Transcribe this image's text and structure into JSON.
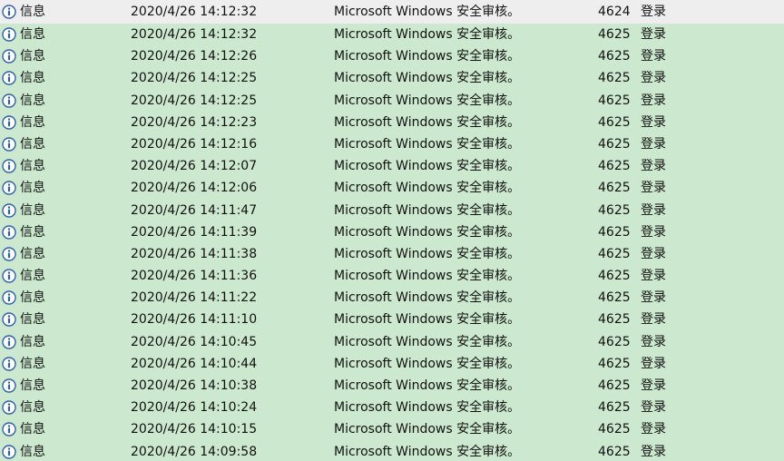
{
  "colors": {
    "background": "#cce8cf",
    "selected_row": "#eeeeee",
    "info_icon": "#2f5fa8"
  },
  "rows": [
    {
      "icon": "info-icon",
      "level": "信息",
      "date": "2020/4/26 14:12:32",
      "source": "Microsoft Windows 安全审核。",
      "event_id": "4624",
      "task": "登录",
      "selected": true
    },
    {
      "icon": "info-icon",
      "level": "信息",
      "date": "2020/4/26 14:12:32",
      "source": "Microsoft Windows 安全审核。",
      "event_id": "4625",
      "task": "登录",
      "selected": false
    },
    {
      "icon": "info-icon",
      "level": "信息",
      "date": "2020/4/26 14:12:26",
      "source": "Microsoft Windows 安全审核。",
      "event_id": "4625",
      "task": "登录",
      "selected": false
    },
    {
      "icon": "info-icon",
      "level": "信息",
      "date": "2020/4/26 14:12:25",
      "source": "Microsoft Windows 安全审核。",
      "event_id": "4625",
      "task": "登录",
      "selected": false
    },
    {
      "icon": "info-icon",
      "level": "信息",
      "date": "2020/4/26 14:12:25",
      "source": "Microsoft Windows 安全审核。",
      "event_id": "4625",
      "task": "登录",
      "selected": false
    },
    {
      "icon": "info-icon",
      "level": "信息",
      "date": "2020/4/26 14:12:23",
      "source": "Microsoft Windows 安全审核。",
      "event_id": "4625",
      "task": "登录",
      "selected": false
    },
    {
      "icon": "info-icon",
      "level": "信息",
      "date": "2020/4/26 14:12:16",
      "source": "Microsoft Windows 安全审核。",
      "event_id": "4625",
      "task": "登录",
      "selected": false
    },
    {
      "icon": "info-icon",
      "level": "信息",
      "date": "2020/4/26 14:12:07",
      "source": "Microsoft Windows 安全审核。",
      "event_id": "4625",
      "task": "登录",
      "selected": false
    },
    {
      "icon": "info-icon",
      "level": "信息",
      "date": "2020/4/26 14:12:06",
      "source": "Microsoft Windows 安全审核。",
      "event_id": "4625",
      "task": "登录",
      "selected": false
    },
    {
      "icon": "info-icon",
      "level": "信息",
      "date": "2020/4/26 14:11:47",
      "source": "Microsoft Windows 安全审核。",
      "event_id": "4625",
      "task": "登录",
      "selected": false
    },
    {
      "icon": "info-icon",
      "level": "信息",
      "date": "2020/4/26 14:11:39",
      "source": "Microsoft Windows 安全审核。",
      "event_id": "4625",
      "task": "登录",
      "selected": false
    },
    {
      "icon": "info-icon",
      "level": "信息",
      "date": "2020/4/26 14:11:38",
      "source": "Microsoft Windows 安全审核。",
      "event_id": "4625",
      "task": "登录",
      "selected": false
    },
    {
      "icon": "info-icon",
      "level": "信息",
      "date": "2020/4/26 14:11:36",
      "source": "Microsoft Windows 安全审核。",
      "event_id": "4625",
      "task": "登录",
      "selected": false
    },
    {
      "icon": "info-icon",
      "level": "信息",
      "date": "2020/4/26 14:11:22",
      "source": "Microsoft Windows 安全审核。",
      "event_id": "4625",
      "task": "登录",
      "selected": false
    },
    {
      "icon": "info-icon",
      "level": "信息",
      "date": "2020/4/26 14:11:10",
      "source": "Microsoft Windows 安全审核。",
      "event_id": "4625",
      "task": "登录",
      "selected": false
    },
    {
      "icon": "info-icon",
      "level": "信息",
      "date": "2020/4/26 14:10:45",
      "source": "Microsoft Windows 安全审核。",
      "event_id": "4625",
      "task": "登录",
      "selected": false
    },
    {
      "icon": "info-icon",
      "level": "信息",
      "date": "2020/4/26 14:10:44",
      "source": "Microsoft Windows 安全审核。",
      "event_id": "4625",
      "task": "登录",
      "selected": false
    },
    {
      "icon": "info-icon",
      "level": "信息",
      "date": "2020/4/26 14:10:38",
      "source": "Microsoft Windows 安全审核。",
      "event_id": "4625",
      "task": "登录",
      "selected": false
    },
    {
      "icon": "info-icon",
      "level": "信息",
      "date": "2020/4/26 14:10:24",
      "source": "Microsoft Windows 安全审核。",
      "event_id": "4625",
      "task": "登录",
      "selected": false
    },
    {
      "icon": "info-icon",
      "level": "信息",
      "date": "2020/4/26 14:10:15",
      "source": "Microsoft Windows 安全审核。",
      "event_id": "4625",
      "task": "登录",
      "selected": false
    },
    {
      "icon": "info-icon",
      "level": "信息",
      "date": "2020/4/26 14:09:58",
      "source": "Microsoft Windows 安全审核。",
      "event_id": "4625",
      "task": "登录",
      "selected": false
    }
  ]
}
